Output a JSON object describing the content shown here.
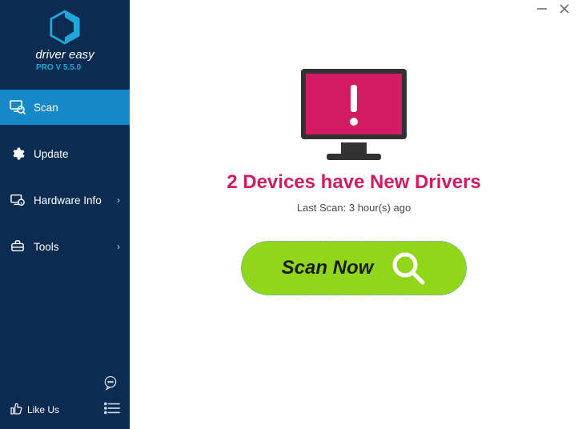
{
  "app": {
    "brand": "driver easy",
    "version": "PRO V 5.5.0"
  },
  "sidebar": {
    "items": [
      {
        "label": "Scan",
        "active": true,
        "has_chevron": false
      },
      {
        "label": "Update",
        "active": false,
        "has_chevron": false
      },
      {
        "label": "Hardware Info",
        "active": false,
        "has_chevron": true
      },
      {
        "label": "Tools",
        "active": false,
        "has_chevron": true
      }
    ],
    "like_label": "Like Us"
  },
  "main": {
    "headline": "2 Devices have New Drivers",
    "last_scan": "Last Scan: 3 hour(s) ago",
    "scan_button": "Scan Now"
  },
  "colors": {
    "accent": "#d21b62",
    "sidebar": "#0b2b51",
    "active": "#1588c8",
    "scan_btn": "#8fd718"
  }
}
